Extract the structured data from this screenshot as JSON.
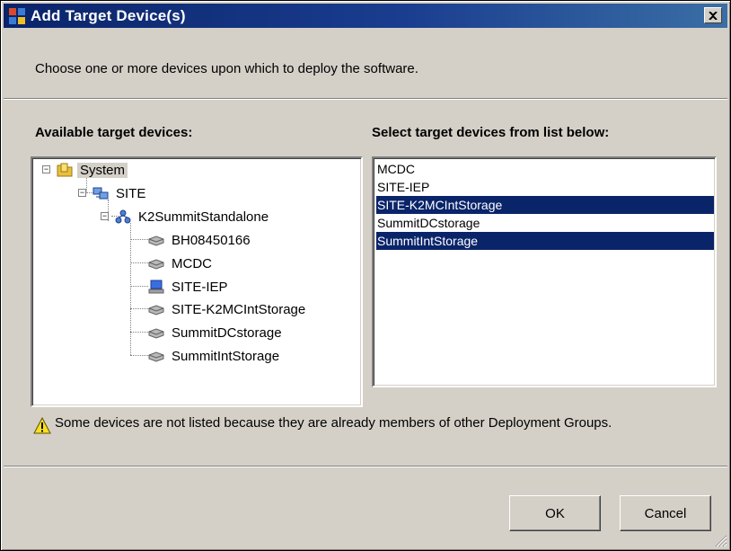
{
  "window": {
    "title": "Add Target Device(s)",
    "instruction": "Choose one or more devices upon which to deploy the software."
  },
  "left_panel": {
    "label": "Available target devices:",
    "tree": [
      {
        "label": "System",
        "icon": "folder-icon",
        "expander": "⊟",
        "selected": true
      },
      {
        "label": "SITE",
        "icon": "site-network-icon",
        "expander": "⊟"
      },
      {
        "label": "K2SummitStandalone",
        "icon": "network-group-icon",
        "expander": "⊟"
      },
      {
        "label": "BH08450166",
        "icon": "storage-device-icon"
      },
      {
        "label": "MCDC",
        "icon": "storage-device-icon"
      },
      {
        "label": "SITE-IEP",
        "icon": "computer-icon"
      },
      {
        "label": "SITE-K2MCIntStorage",
        "icon": "storage-device-icon"
      },
      {
        "label": "SummitDCstorage",
        "icon": "storage-device-icon"
      },
      {
        "label": "SummitIntStorage",
        "icon": "storage-device-icon"
      }
    ]
  },
  "right_panel": {
    "label": "Select target devices from list below:",
    "items": [
      {
        "label": "MCDC",
        "selected": false
      },
      {
        "label": "SITE-IEP",
        "selected": false
      },
      {
        "label": "SITE-K2MCIntStorage",
        "selected": true
      },
      {
        "label": "SummitDCstorage",
        "selected": false
      },
      {
        "label": "SummitIntStorage",
        "selected": true
      }
    ]
  },
  "warning": {
    "icon": "warning-icon",
    "text": "Some devices are not listed because they are already members of other Deployment Groups."
  },
  "buttons": {
    "ok": "OK",
    "cancel": "Cancel"
  },
  "colors": {
    "title_bar": "#0a246a",
    "selection": "#0a246a",
    "dialog_background": "#d4d0c8"
  }
}
